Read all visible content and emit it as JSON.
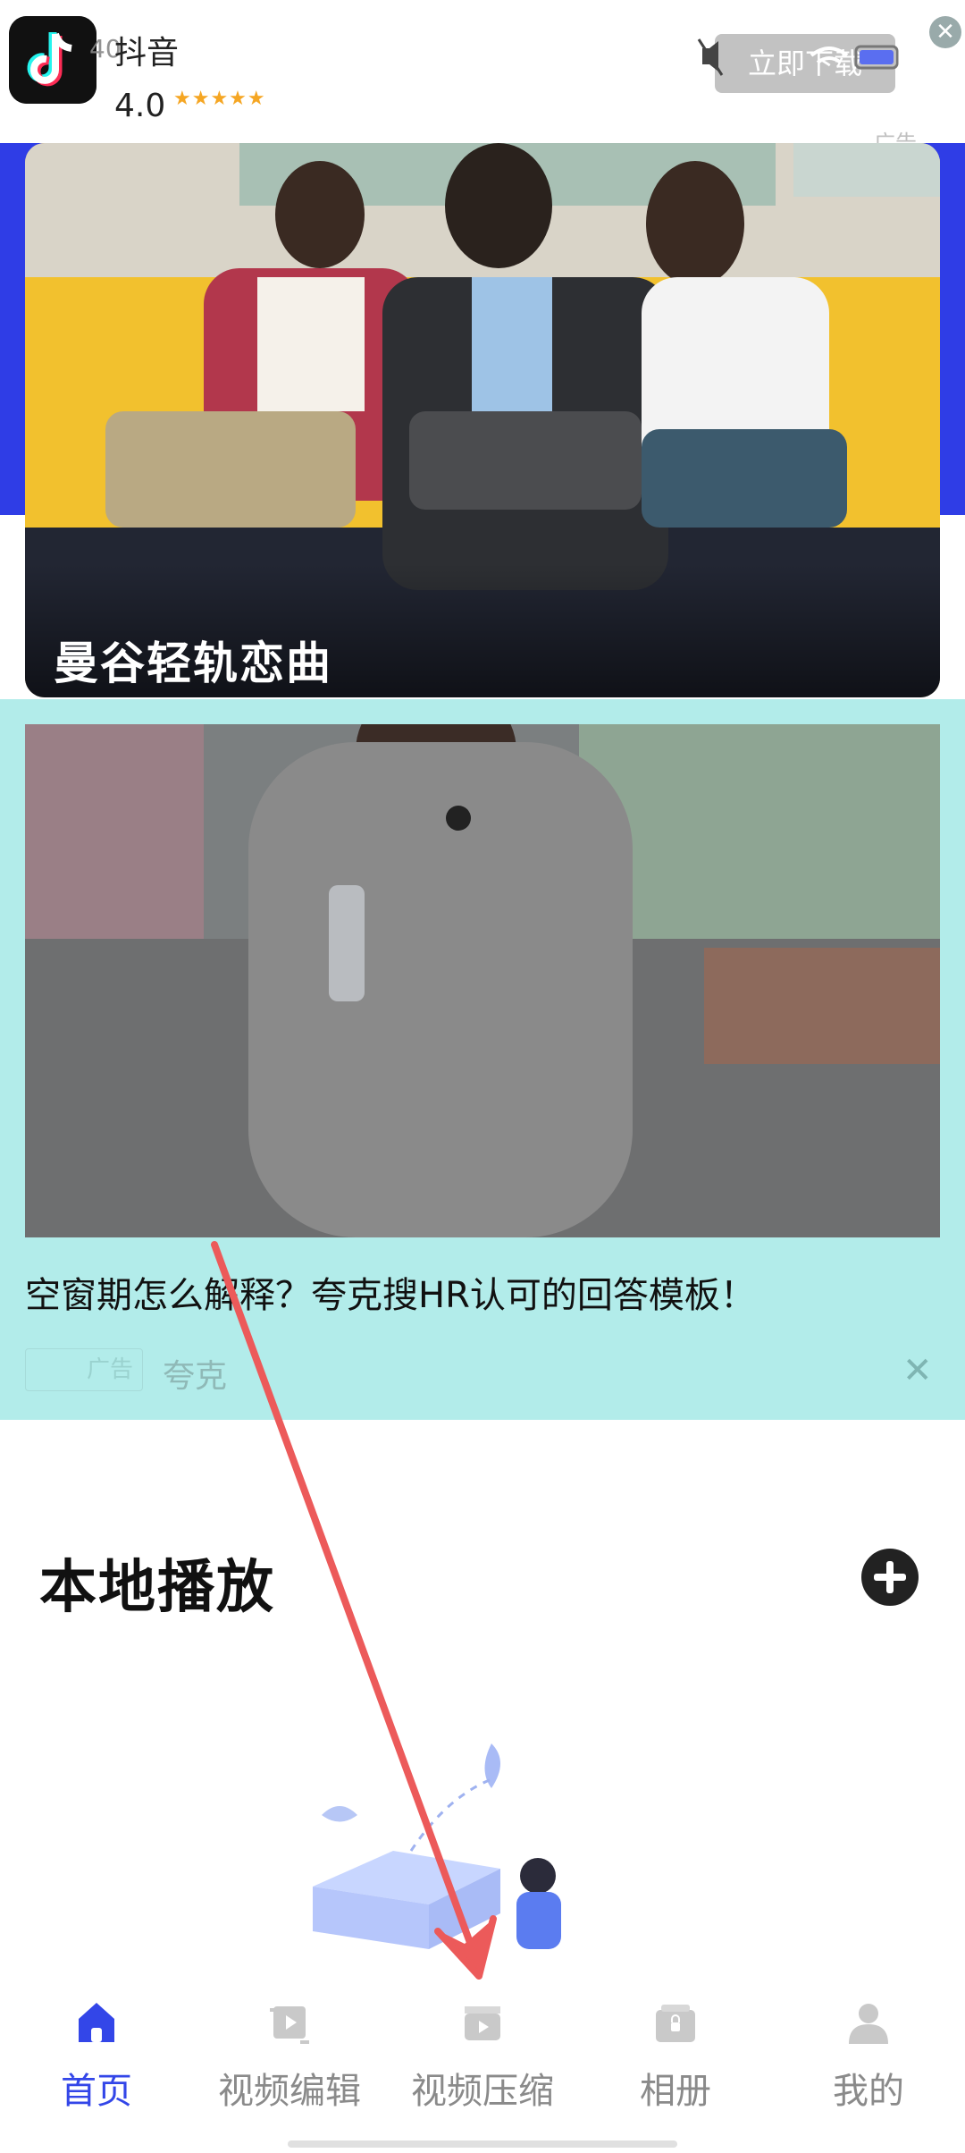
{
  "ad_banner": {
    "app_name": "抖音",
    "rating": "4.0",
    "stars": "★★★★★",
    "status_overlay": "40",
    "download_label": "立即下载",
    "ad_tag": "广告",
    "close_glyph": "✕"
  },
  "hero": {
    "title": "曼谷轻轨恋曲"
  },
  "native_ad": {
    "title": "空窗期怎么解释？夸克搜HR认可的回答模板！",
    "badge_label": "广告",
    "source": "夸克",
    "close_glyph": "✕"
  },
  "local_play": {
    "title": "本地播放"
  },
  "bottom_nav": {
    "items": [
      {
        "label": "首页",
        "icon": "home-icon",
        "active": true
      },
      {
        "label": "视频编辑",
        "icon": "video-edit-icon",
        "active": false
      },
      {
        "label": "视频压缩",
        "icon": "video-compress-icon",
        "active": false
      },
      {
        "label": "相册",
        "icon": "album-icon",
        "active": false
      },
      {
        "label": "我的",
        "icon": "profile-icon",
        "active": false
      }
    ],
    "active_color": "#3346e8",
    "inactive_color": "#8a8a8a"
  },
  "colors": {
    "hero_band": "#2f3de6",
    "native_ad_bg": "#b2ecea",
    "annotation_arrow": "#ec5a5a"
  }
}
